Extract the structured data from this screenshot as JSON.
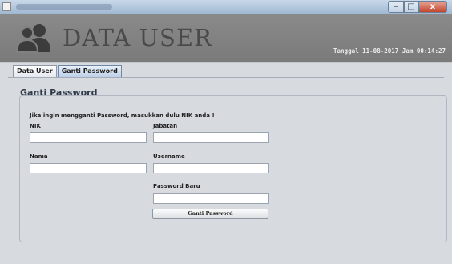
{
  "window": {
    "min_glyph": "–",
    "max_glyph": "□",
    "close_glyph": "x"
  },
  "header": {
    "title": "DATA USER",
    "date_text": "Tanggal 11-08-2017 Jam 00:14:27"
  },
  "tabs": [
    {
      "label": "Data User",
      "selected": false
    },
    {
      "label": "Ganti Password",
      "selected": true
    }
  ],
  "form": {
    "section_title": "Ganti Password",
    "instruction": "Jika ingin mengganti Password, masukkan dulu NIK anda !",
    "nik_label": "NIK",
    "nik_value": "",
    "jabatan_label": "Jabatan",
    "jabatan_value": "",
    "nama_label": "Nama",
    "nama_value": "",
    "username_label": "Username",
    "username_value": "",
    "password_baru_label": "Password Baru",
    "password_baru_value": "",
    "submit_label": "Ganti Password"
  },
  "icons": {
    "app": "app-icon",
    "header": "users-icon"
  },
  "colors": {
    "header_bg": "#808080",
    "content_bg": "#d7dbe0",
    "title_text": "#4a4a4a",
    "close_button": "#c4462e"
  }
}
